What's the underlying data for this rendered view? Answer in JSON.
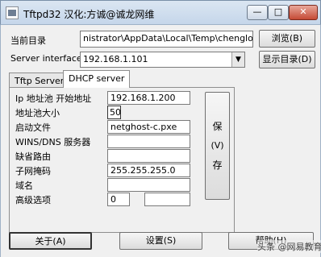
{
  "window": {
    "title": "Tftpd32 汉化:方诚@诚龙网维",
    "min_label": "—",
    "max_label": "□",
    "close_label": "✕"
  },
  "form": {
    "current_dir_label": "当前目录",
    "current_dir_value": "nistrator\\AppData\\Local\\Temp\\chenglong",
    "browse_label": "浏览(B)",
    "server_if_label": "Server interfaces",
    "server_if_value": "192.168.1.101",
    "show_dir_label": "显示目录(D)"
  },
  "tabs": [
    {
      "label": "Tftp Server"
    },
    {
      "label": "DHCP server"
    }
  ],
  "dhcp": {
    "ip_pool_label": "Ip 地址池 开始地址",
    "ip_pool_value": "192.168.1.200",
    "pool_size_label": "地址池大小",
    "pool_size_value": "50",
    "boot_file_label": "启动文件",
    "boot_file_value": "netghost-c.pxe",
    "wins_dns_label": "WINS/DNS 服务器",
    "wins_dns_value": "",
    "default_route_label": "缺省路由",
    "default_route_value": "",
    "subnet_label": "子网掩码",
    "subnet_value": "255.255.255.0",
    "domain_label": "域名",
    "domain_value": "",
    "advanced_label": "高级选项",
    "advanced_value1": "0",
    "advanced_value2": "",
    "save_label_top": "保",
    "save_label_mid": "(V)",
    "save_label_bot": "存"
  },
  "bottom": {
    "about_label": "关于(A)",
    "settings_label": "设置(S)",
    "help_label": "帮助(H)",
    "watermark": "头条 @网易教育"
  }
}
